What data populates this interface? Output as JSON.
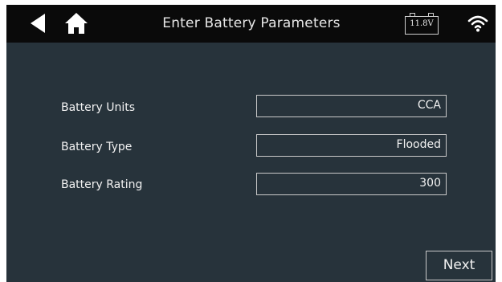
{
  "header": {
    "title": "Enter Battery Parameters",
    "battery_voltage": "11.8V"
  },
  "form": {
    "rows": [
      {
        "label": "Battery Units",
        "value": "CCA"
      },
      {
        "label": "Battery Type",
        "value": "Flooded"
      },
      {
        "label": "Battery Rating",
        "value": "300"
      }
    ]
  },
  "footer": {
    "next_label": "Next"
  },
  "icons": {
    "back": "back-arrow-icon",
    "home": "home-icon",
    "battery": "battery-icon",
    "wifi": "wifi-icon"
  },
  "colors": {
    "background": "#27333b",
    "header": "#0a0a0a",
    "text": "#f2f2f2",
    "border": "#c9c9c9"
  }
}
